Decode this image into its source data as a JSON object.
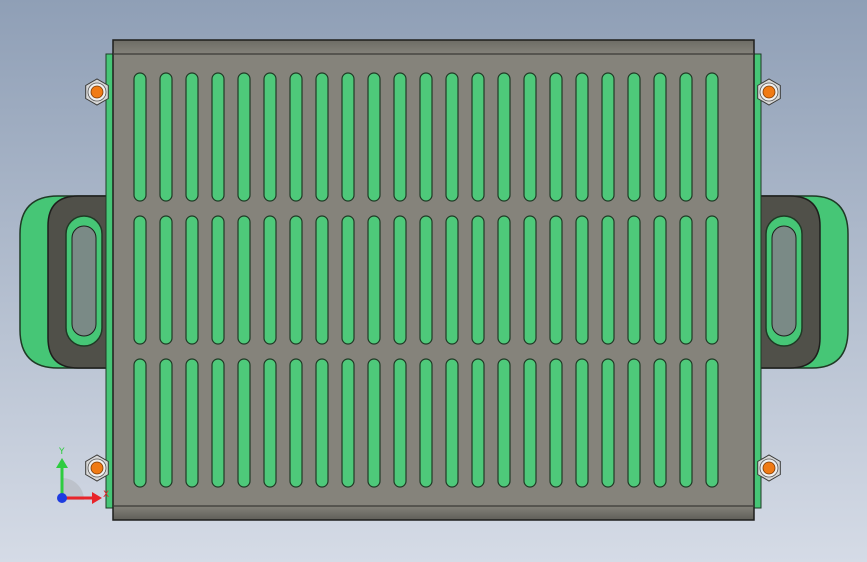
{
  "viewport": {
    "background_top": "#8f9fb6",
    "background_bottom": "#d5dbe6"
  },
  "model": {
    "plate_color": "#828078",
    "plate_dark": "#5a5952",
    "slot_color": "#4ec97a",
    "slot_outline": "#1f3a25",
    "handle_green": "#46c676",
    "handle_gray": "#505049",
    "nut_color": "#d7d7d7",
    "bolt_color": "#f07a14",
    "slot_rows": 3,
    "slot_columns": 23
  },
  "triad": {
    "x_label": "X",
    "y_label": "Y",
    "x_color": "#e8242a",
    "y_color": "#2ecc40",
    "z_color": "#1e3ce0"
  }
}
